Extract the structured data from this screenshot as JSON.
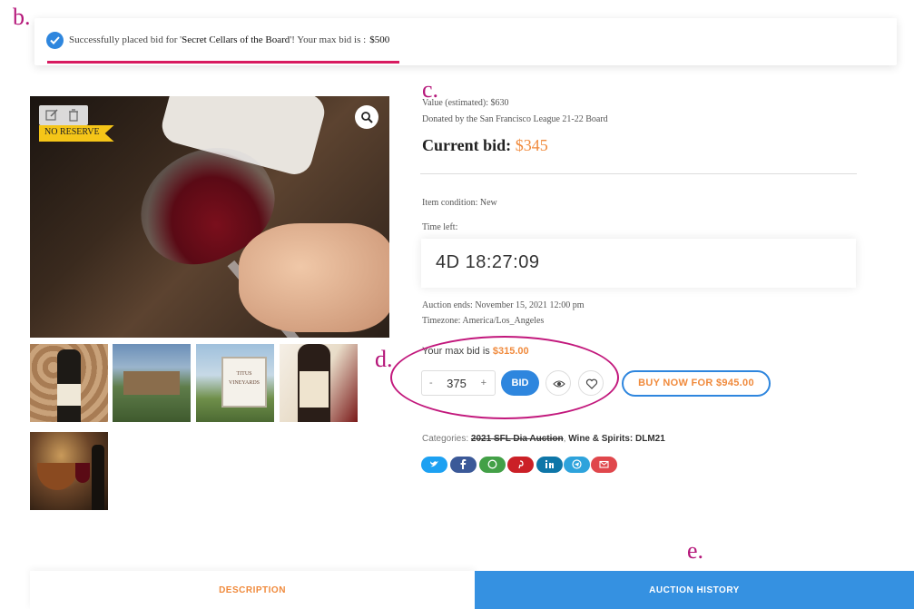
{
  "annotations": {
    "b": "b.",
    "c": "c.",
    "d": "d.",
    "e": "e."
  },
  "notice": {
    "prefix": "Successfully placed bid for '",
    "item": "Secret Cellars of the Board",
    "middle": "'! Your max bid is :",
    "amount": "$500",
    "icon": "check-circle-icon",
    "accent": "#2e86de",
    "progress_color": "#d81b60"
  },
  "image": {
    "badge": "NO RESERVE",
    "badge_color": "#f5c518",
    "tool_icons": [
      "edit-icon",
      "trash-icon"
    ],
    "zoom_icon": "zoom-icon"
  },
  "thumbnails": [
    "thumb-wine-bottle-corks",
    "thumb-winery-building",
    "thumb-titus-vineyards-sign",
    "thumb-wine-bottle",
    "thumb-fondue-wine"
  ],
  "thumb_sign_text": [
    "TITUS",
    "VINEYARDS"
  ],
  "details": {
    "value": "Value (estimated): $630",
    "donated": "Donated by the San Francisco League 21-22 Board",
    "current_bid_label": "Current bid:",
    "current_bid_value": "$345",
    "condition": "Item condition: New",
    "time_left_label": "Time left:",
    "time_left": "4D 18:27:09",
    "ends": "Auction ends: November 15, 2021 12:00 pm",
    "timezone": "Timezone: America/Los_Angeles",
    "accent_orange": "#f08a3c"
  },
  "bid": {
    "max_bid_label": "Your max bid is",
    "max_bid_value": "$315.00",
    "minus": "-",
    "qty": "375",
    "plus": "+",
    "bid_label": "BID",
    "watch_icon": "eye-icon",
    "wishlist_icon": "heart-icon",
    "buy_now_label": "BUY NOW FOR $945.00"
  },
  "categories": {
    "label": "Categories:",
    "items": [
      "2021 SFL Dia Auction",
      "Wine & Spirits: DLM21"
    ]
  },
  "share": [
    {
      "icon": "twitter-icon",
      "color": "#1da1f2"
    },
    {
      "icon": "facebook-icon",
      "color": "#3b5998"
    },
    {
      "icon": "whatsapp-icon",
      "color": "#43a047"
    },
    {
      "icon": "pinterest-icon",
      "color": "#cb2027"
    },
    {
      "icon": "linkedin-icon",
      "color": "#0e76a8"
    },
    {
      "icon": "telegram-icon",
      "color": "#2ea3dc"
    },
    {
      "icon": "email-icon",
      "color": "#e0474c"
    }
  ],
  "tabs": {
    "description": "DESCRIPTION",
    "history": "AUCTION HISTORY"
  }
}
